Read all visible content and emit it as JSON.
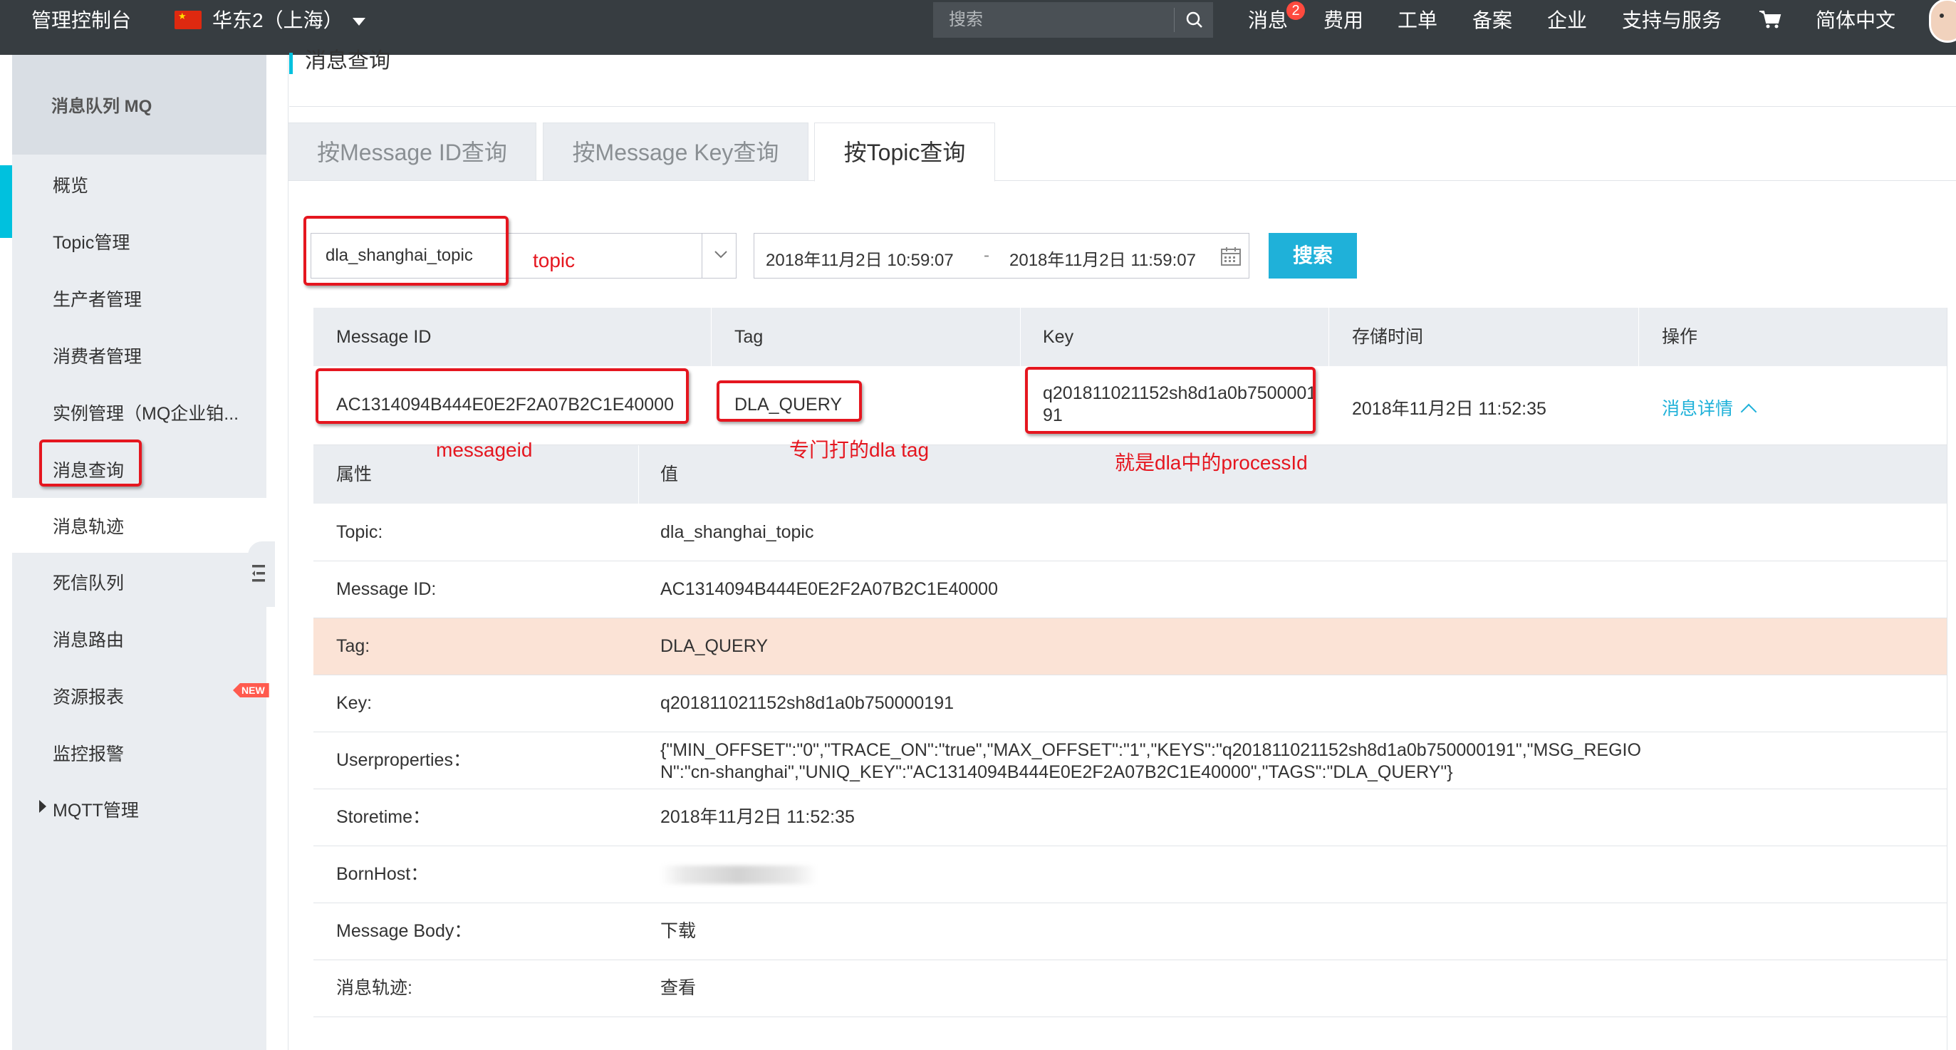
{
  "topbar": {
    "console_title": "管理控制台",
    "region": "华东2（上海）",
    "search_placeholder": "搜索",
    "nav": [
      "消息",
      "费用",
      "工单",
      "备案",
      "企业",
      "支持与服务",
      "简体中文"
    ],
    "messages_badge": "2",
    "flag_glyph": "★"
  },
  "sidebar": {
    "header": "消息队列 MQ",
    "items": [
      "概览",
      "Topic管理",
      "生产者管理",
      "消费者管理",
      "实例管理（MQ企业铂...",
      "消息查询",
      "消息轨迹",
      "死信队列",
      "消息路由",
      "资源报表",
      "监控报警",
      "MQTT管理"
    ],
    "new_badge": "NEW"
  },
  "main": {
    "title": "消息查询",
    "tabs": [
      "按Message ID查询",
      "按Message Key查询",
      "按Topic查询"
    ],
    "query": {
      "topic_value": "dla_shanghai_topic",
      "start_time": "2018年11月2日 10:59:07",
      "range_separator": "-",
      "end_time": "2018年11月2日 11:59:07",
      "search_button": "搜索"
    },
    "table": {
      "headers": [
        "Message ID",
        "Tag",
        "Key",
        "存储时间",
        "操作"
      ],
      "row": {
        "message_id": "AC1314094B444E0E2F2A07B2C1E40000",
        "tag": "DLA_QUERY",
        "key_line1": "q201811021152sh8d1a0b7500001",
        "key_line2": "91",
        "store_time": "2018年11月2日 11:52:35",
        "action": "消息详情"
      }
    },
    "detail": {
      "headers": [
        "属性",
        "值"
      ],
      "rows": [
        {
          "k": "Topic:",
          "v": "dla_shanghai_topic"
        },
        {
          "k": "Message ID:",
          "v": "AC1314094B444E0E2F2A07B2C1E40000"
        },
        {
          "k": "Tag:",
          "v": "DLA_QUERY"
        },
        {
          "k": "Key:",
          "v": "q201811021152sh8d1a0b750000191"
        },
        {
          "k": "Userproperties：",
          "v": "{\"MIN_OFFSET\":\"0\",\"TRACE_ON\":\"true\",\"MAX_OFFSET\":\"1\",\"KEYS\":\"q201811021152sh8d1a0b750000191\",\"MSG_REGION\":\"cn-shanghai\",\"UNIQ_KEY\":\"AC1314094B444E0E2F2A07B2C1E40000\",\"TAGS\":\"DLA_QUERY\"}"
        },
        {
          "k": "Storetime：",
          "v": "2018年11月2日 11:52:35"
        },
        {
          "k": "BornHost：",
          "v": ""
        },
        {
          "k": "Message Body：",
          "v": "下载"
        },
        {
          "k": "消息轨迹:",
          "v": "查看"
        }
      ]
    }
  },
  "annotations": {
    "topic": "topic",
    "messageid": "messageid",
    "tag": "专门打的dla tag",
    "key": "就是dla中的processId"
  },
  "colors": {
    "topbar": "#373d41",
    "accent": "#00c1de",
    "primary_button": "#1fb1d9",
    "annotation_red": "#e5161f",
    "highlight_row": "#fbe3d6",
    "sidebar_bg": "#eaedf1"
  }
}
